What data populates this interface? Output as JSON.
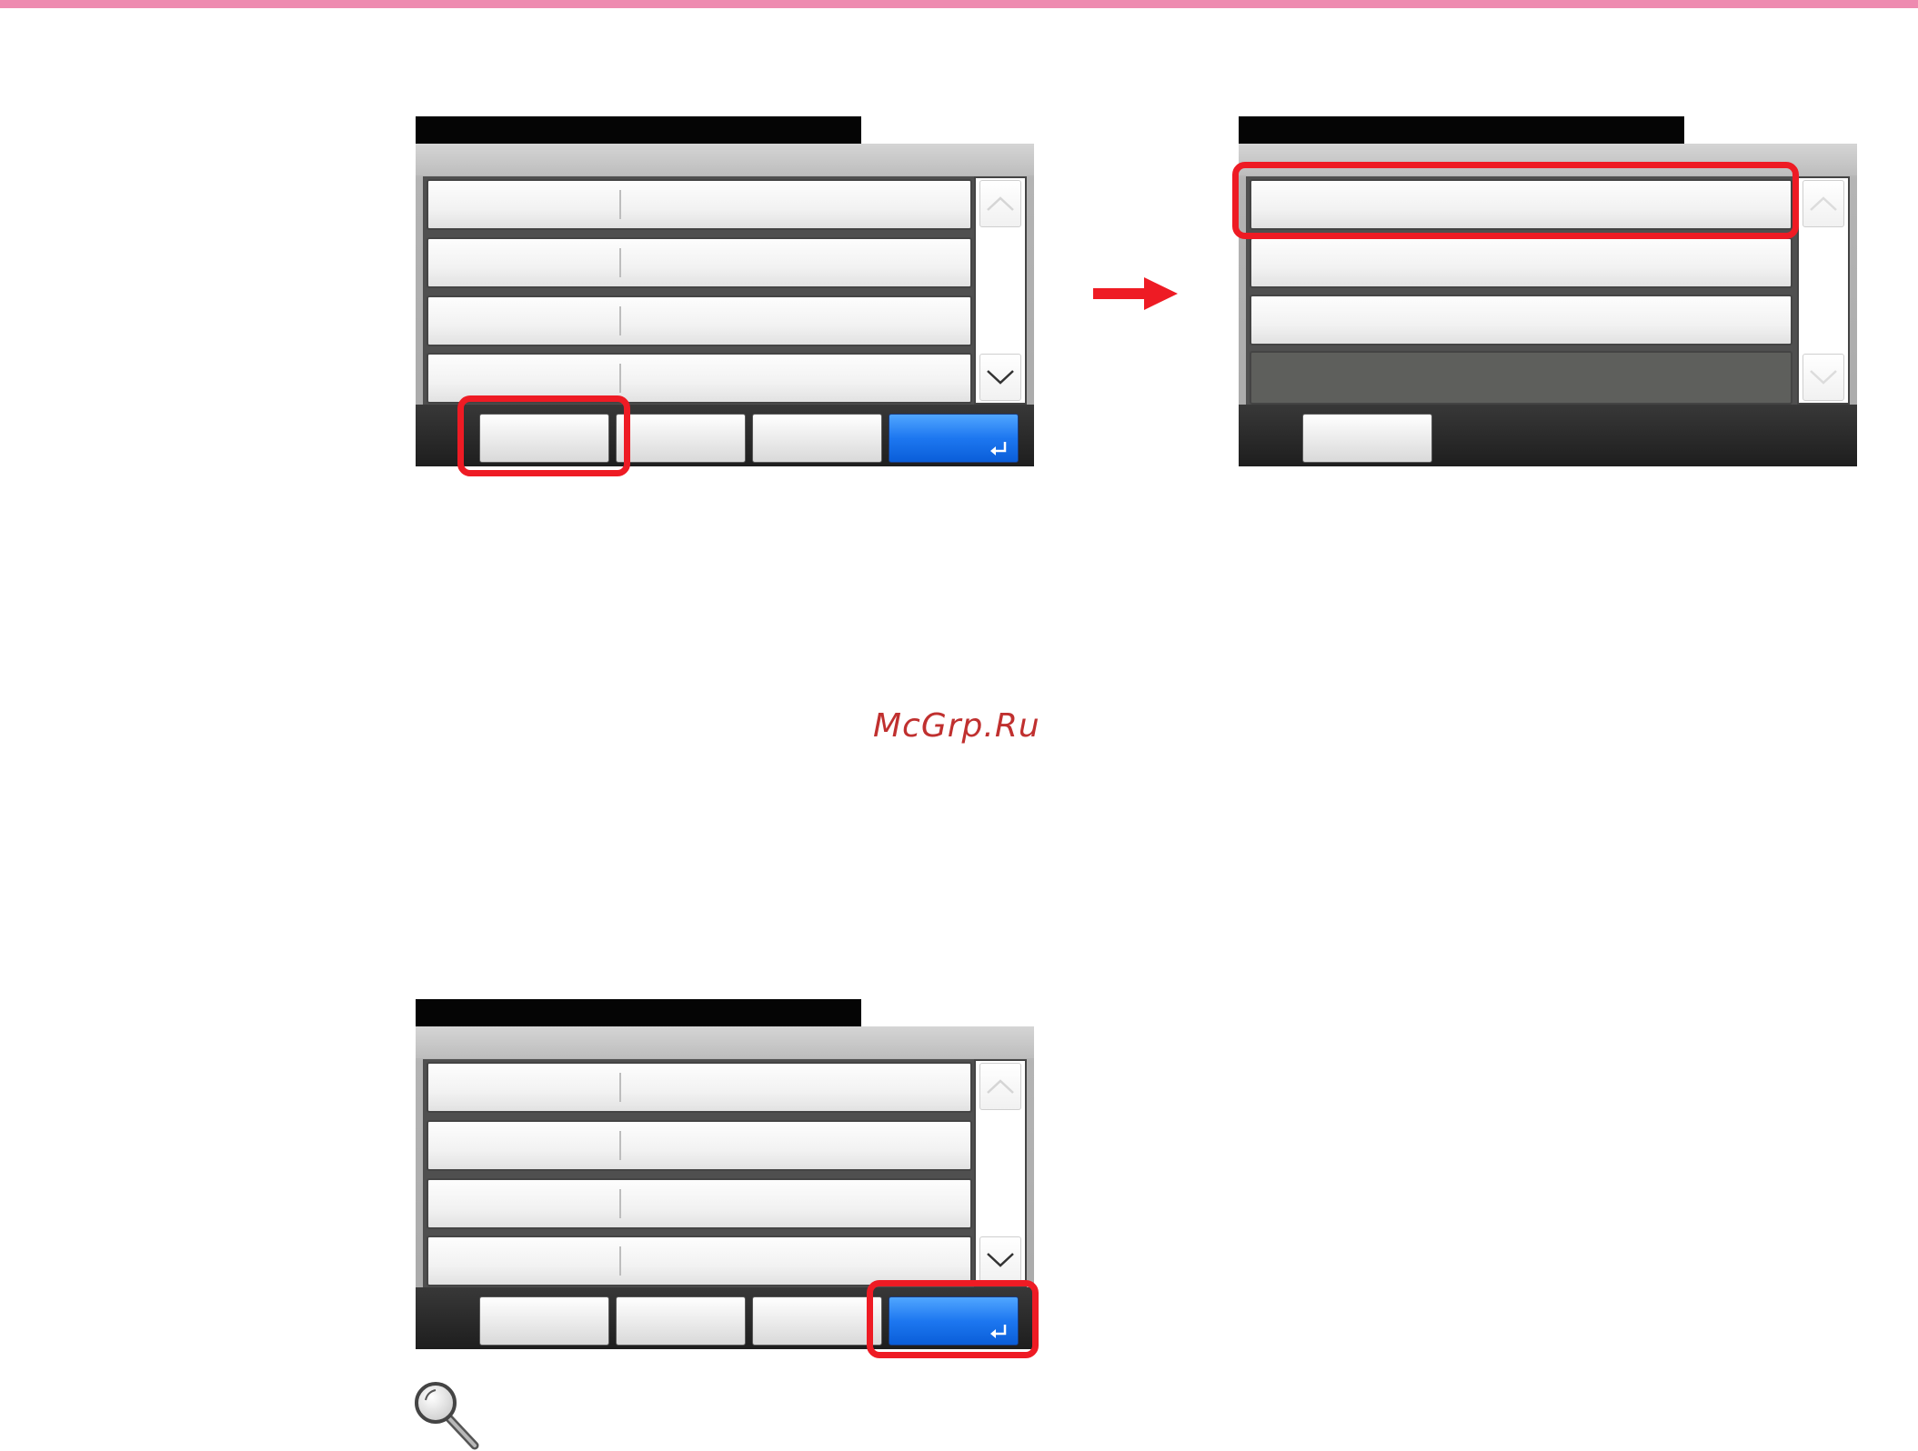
{
  "watermark": "McGrp.Ru",
  "colors": {
    "header_bar": "#ee8bb0",
    "highlight": "#ee1b24",
    "arrow": "#ee1b24",
    "confirm_button": "#1d77f0"
  },
  "icons": {
    "scroll_up": "chevron-up-icon",
    "scroll_down": "chevron-down-icon",
    "confirm": "enter-icon",
    "next_step": "arrow-right-icon",
    "note": "magnifier-icon"
  }
}
